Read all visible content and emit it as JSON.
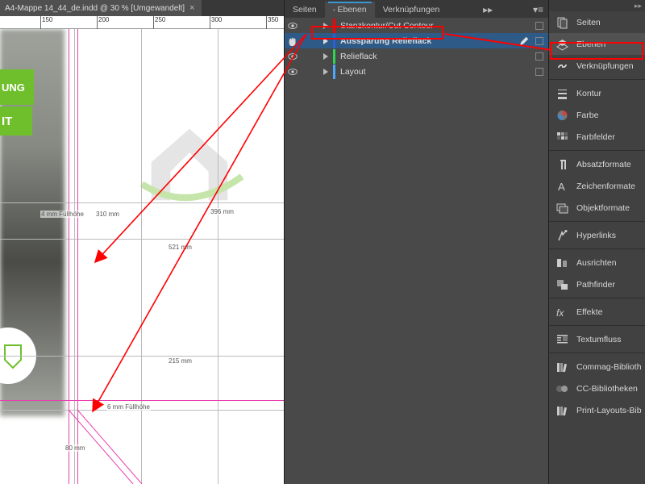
{
  "doc_tab": {
    "title": "A4-Mappe 14_44_de.indd @ 30 % [Umgewandelt]"
  },
  "ruler_ticks": [
    {
      "pos": 50,
      "label": "150"
    },
    {
      "pos": 120,
      "label": "200"
    },
    {
      "pos": 190,
      "label": "250"
    },
    {
      "pos": 260,
      "label": "300"
    },
    {
      "pos": 330,
      "label": "350"
    }
  ],
  "canvas_labels": {
    "fill_left": "4 mm Füllhöhe",
    "d310": "310 mm",
    "d396": "396 mm",
    "d521": "521 mm",
    "d215": "215 mm",
    "fill_bottom": "6 mm Füllhöhe",
    "d80": "80 mm",
    "green1": "UNG",
    "green2": "IT"
  },
  "panel_tabs": {
    "seiten": "Seiten",
    "ebenen": "Ebenen",
    "verknuepfungen": "Verknüpfungen"
  },
  "layers": [
    {
      "name": "Stanzkontur/Cut Contour",
      "color": "#ff0000"
    },
    {
      "name": "Aussparung Relieflack",
      "color": "#2b5fd9"
    },
    {
      "name": "Relieflack",
      "color": "#2bd94e"
    },
    {
      "name": "Layout",
      "color": "#4aa8ff"
    }
  ],
  "sidebar": [
    {
      "key": "seiten",
      "label": "Seiten"
    },
    {
      "key": "ebenen",
      "label": "Ebenen"
    },
    {
      "key": "verknuepfungen",
      "label": "Verknüpfungen"
    },
    {
      "sep": true
    },
    {
      "key": "kontur",
      "label": "Kontur"
    },
    {
      "key": "farbe",
      "label": "Farbe"
    },
    {
      "key": "farbfelder",
      "label": "Farbfelder"
    },
    {
      "sep": true
    },
    {
      "key": "absatzformate",
      "label": "Absatzformate"
    },
    {
      "key": "zeichenformate",
      "label": "Zeichenformate"
    },
    {
      "key": "objektformate",
      "label": "Objektformate"
    },
    {
      "sep": true
    },
    {
      "key": "hyperlinks",
      "label": "Hyperlinks"
    },
    {
      "sep": true
    },
    {
      "key": "ausrichten",
      "label": "Ausrichten"
    },
    {
      "key": "pathfinder",
      "label": "Pathfinder"
    },
    {
      "sep": true
    },
    {
      "key": "effekte",
      "label": "Effekte"
    },
    {
      "sep": true
    },
    {
      "key": "textumfluss",
      "label": "Textumfluss"
    },
    {
      "sep": true
    },
    {
      "key": "commag",
      "label": "Commag-Biblioth"
    },
    {
      "key": "cc",
      "label": "CC-Bibliotheken"
    },
    {
      "key": "print",
      "label": "Print-Layouts-Bib"
    }
  ]
}
